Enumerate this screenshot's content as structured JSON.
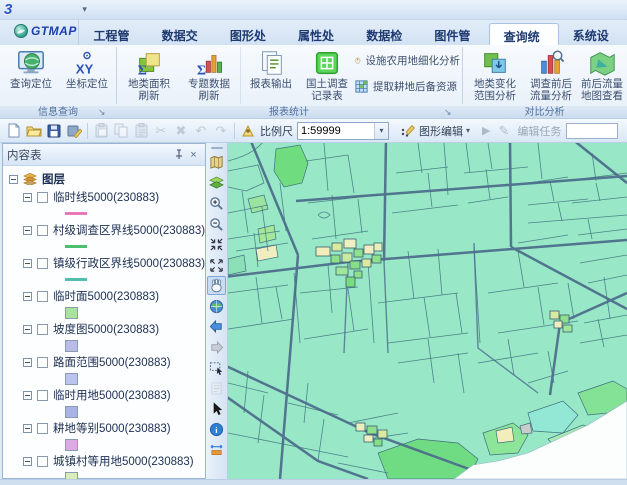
{
  "titlebar": {
    "app_icon_glyph": "3",
    "quick_access_caret": "▾"
  },
  "brand": {
    "name": "GTMAP"
  },
  "tabs": [
    {
      "label": "工程管理",
      "active": false
    },
    {
      "label": "数据交换",
      "active": false
    },
    {
      "label": "图形处理",
      "active": false
    },
    {
      "label": "属性处理",
      "active": false
    },
    {
      "label": "数据检查",
      "active": false
    },
    {
      "label": "图件管理",
      "active": false
    },
    {
      "label": "查询统计",
      "active": true
    },
    {
      "label": "系统设置",
      "active": false
    }
  ],
  "ribbon": {
    "groups": [
      {
        "label": "信息查询",
        "has_launcher": true
      },
      {
        "label": "报表统计",
        "has_launcher": true
      },
      {
        "label": "对比分析",
        "has_launcher": false
      }
    ],
    "buttons": {
      "query_locate": "查询定位",
      "coord_locate": "坐标定位",
      "area_refresh": "地类面积刷新",
      "thematic_refresh": "专题数据刷新",
      "report_output": "报表输出",
      "survey_record": "国土调查记录表",
      "facility_analysis": "设施农用地细化分析",
      "reserve_extract": "提取耕地后备资源",
      "change_range": "地类变化范围分析",
      "flow_analysis": "调查前后流量分析",
      "flow_map_view": "前后流量地图查看"
    }
  },
  "toolbar": {
    "scale_label": "比例尺",
    "scale_value": "1:59999",
    "graphic_edit_label": "图形编辑",
    "edit_task_label": "编辑任务",
    "task_value": ""
  },
  "content_panel": {
    "title": "内容表",
    "root_label": "图层",
    "layers": [
      {
        "name": "临时线5000(230883)",
        "symbol": "line",
        "color": "#e878b8"
      },
      {
        "name": "村级调查区界线5000(230883)",
        "symbol": "line",
        "color": "#4bbf6e"
      },
      {
        "name": "镇级行政区界线5000(230883)",
        "symbol": "line",
        "color": "#52bfae"
      },
      {
        "name": "临时面5000(230883)",
        "symbol": "fill",
        "color": "#a8e39c"
      },
      {
        "name": "坡度图5000(230883)",
        "symbol": "fill",
        "color": "#b9bce9"
      },
      {
        "name": "路面范围5000(230883)",
        "symbol": "fill",
        "color": "#bcc3ec"
      },
      {
        "name": "临时用地5000(230883)",
        "symbol": "fill",
        "color": "#a9b4e6"
      },
      {
        "name": "耕地等别5000(230883)",
        "symbol": "fill",
        "color": "#dca9e4"
      },
      {
        "name": "城镇村等用地5000(230883)",
        "symbol": "fill",
        "color": "#d9edbb"
      }
    ]
  },
  "map": {
    "colors": {
      "base": "#98e7c6",
      "road": "#4d6e8c",
      "parcel_line": "#40707e",
      "bright_green": "#70dc80",
      "cream": "#f1edb9",
      "white_area": "#fcfefe"
    }
  },
  "icons": {
    "launcher": "↘",
    "dropdown_caret": "▾",
    "close": "×",
    "scissors": "✂",
    "delete": "✖",
    "undo": "↶",
    "redo": "↷",
    "disabled_play": "▶",
    "disabled_pencil": "✎"
  }
}
